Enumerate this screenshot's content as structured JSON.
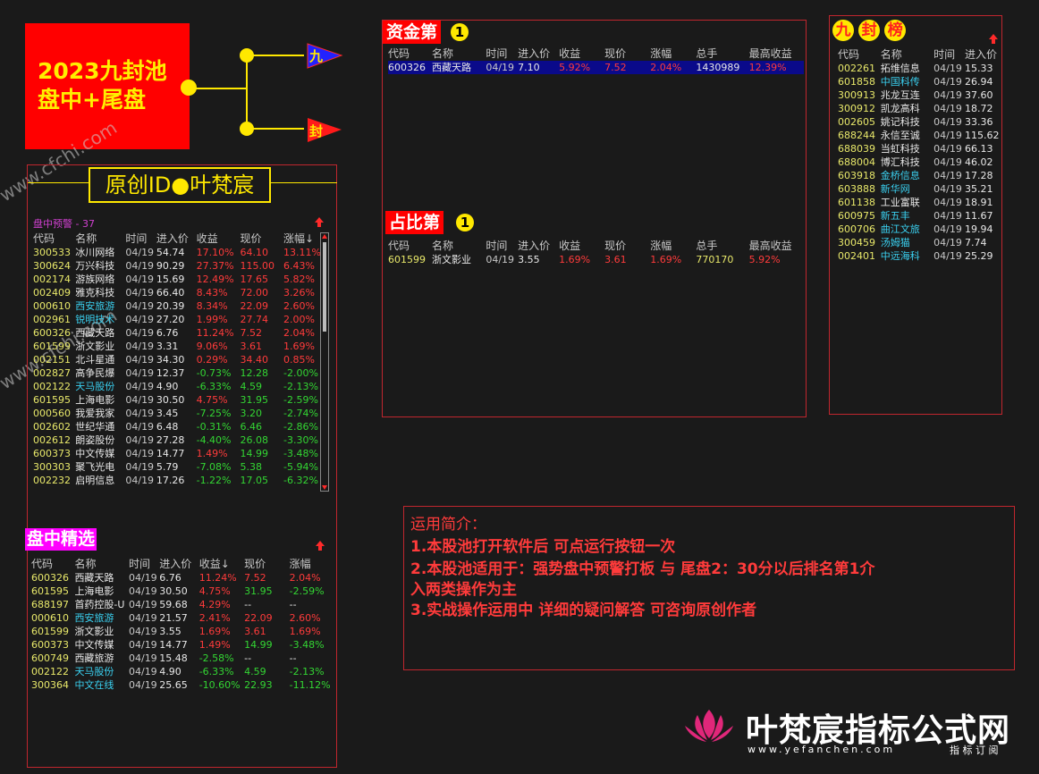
{
  "logo": {
    "line1": "2023九封池",
    "line2": "盘中+尾盘"
  },
  "flow": {
    "flag_top": "九",
    "flag_bottom": "封"
  },
  "creator_banner": "原创ID●叶梵宸",
  "panel_left": {
    "alert_title": "盘中预警 - 37",
    "headers": [
      "代码",
      "名称",
      "时间",
      "进入价",
      "收益",
      "现价",
      "涨幅↓"
    ],
    "rows": [
      [
        "300533",
        "冰川网络",
        "04/19",
        "54.74",
        "17.10%",
        "64.10",
        "13.11%"
      ],
      [
        "300624",
        "万兴科技",
        "04/19",
        "90.29",
        "27.37%",
        "115.00",
        "6.43%"
      ],
      [
        "002174",
        "游族网络",
        "04/19",
        "15.69",
        "12.49%",
        "17.65",
        "5.82%"
      ],
      [
        "002409",
        "雅克科技",
        "04/19",
        "66.40",
        "8.43%",
        "72.00",
        "3.26%"
      ],
      [
        "000610",
        "西安旅游",
        "04/19",
        "20.39",
        "8.34%",
        "22.09",
        "2.60%"
      ],
      [
        "002961",
        "锐明技术",
        "04/19",
        "27.20",
        "1.99%",
        "27.74",
        "2.00%"
      ],
      [
        "600326",
        "西藏天路",
        "04/19",
        "6.76",
        "11.24%",
        "7.52",
        "2.04%"
      ],
      [
        "601599",
        "浙文影业",
        "04/19",
        "3.31",
        "9.06%",
        "3.61",
        "1.69%"
      ],
      [
        "002151",
        "北斗星通",
        "04/19",
        "34.30",
        "0.29%",
        "34.40",
        "0.85%"
      ],
      [
        "002827",
        "高争民爆",
        "04/19",
        "12.37",
        "-0.73%",
        "12.28",
        "-2.00%"
      ],
      [
        "002122",
        "天马股份",
        "04/19",
        "4.90",
        "-6.33%",
        "4.59",
        "-2.13%"
      ],
      [
        "601595",
        "上海电影",
        "04/19",
        "30.50",
        "4.75%",
        "31.95",
        "-2.59%"
      ],
      [
        "000560",
        "我爱我家",
        "04/19",
        "3.45",
        "-7.25%",
        "3.20",
        "-2.74%"
      ],
      [
        "002602",
        "世纪华通",
        "04/19",
        "6.48",
        "-0.31%",
        "6.46",
        "-2.86%"
      ],
      [
        "002612",
        "朗姿股份",
        "04/19",
        "27.28",
        "-4.40%",
        "26.08",
        "-3.30%"
      ],
      [
        "600373",
        "中文传媒",
        "04/19",
        "14.77",
        "1.49%",
        "14.99",
        "-3.48%"
      ],
      [
        "300303",
        "聚飞光电",
        "04/19",
        "5.79",
        "-7.08%",
        "5.38",
        "-5.94%"
      ],
      [
        "002232",
        "启明信息",
        "04/19",
        "17.26",
        "-1.22%",
        "17.05",
        "-6.32%"
      ]
    ],
    "cyan_names": [
      "西安旅游",
      "锐明技术",
      "天马股份"
    ],
    "selected_title": "盘中精选",
    "selected_headers": [
      "代码",
      "名称",
      "时间",
      "进入价",
      "收益↓",
      "现价",
      "涨幅"
    ],
    "selected_rows": [
      [
        "600326",
        "西藏天路",
        "04/19",
        "6.76",
        "11.24%",
        "7.52",
        "2.04%"
      ],
      [
        "601595",
        "上海电影",
        "04/19",
        "30.50",
        "4.75%",
        "31.95",
        "-2.59%"
      ],
      [
        "688197",
        "首药控股-U",
        "04/19",
        "59.68",
        "4.29%",
        "--",
        "--"
      ],
      [
        "000610",
        "西安旅游",
        "04/19",
        "21.57",
        "2.41%",
        "22.09",
        "2.60%"
      ],
      [
        "601599",
        "浙文影业",
        "04/19",
        "3.55",
        "1.69%",
        "3.61",
        "1.69%"
      ],
      [
        "600373",
        "中文传媒",
        "04/19",
        "14.77",
        "1.49%",
        "14.99",
        "-3.48%"
      ],
      [
        "600749",
        "西藏旅游",
        "04/19",
        "15.48",
        "-2.58%",
        "--",
        "--"
      ],
      [
        "002122",
        "天马股份",
        "04/19",
        "4.90",
        "-6.33%",
        "4.59",
        "-2.13%"
      ],
      [
        "300364",
        "中文在线",
        "04/19",
        "25.65",
        "-10.60%",
        "22.93",
        "-11.12%"
      ]
    ],
    "selected_cyan": [
      "西安旅游",
      "天马股份",
      "中文在线"
    ]
  },
  "panel_capital": {
    "title": "资金第",
    "badge": "1",
    "headers": [
      "代码",
      "名称",
      "时间",
      "进入价",
      "收益",
      "现价",
      "涨幅",
      "总手",
      "最高收益"
    ],
    "row": [
      "600326",
      "西藏天路",
      "04/19",
      "7.10",
      "5.92%",
      "7.52",
      "2.04%",
      "1430989",
      "12.39%"
    ]
  },
  "panel_ratio": {
    "title": "占比第",
    "badge": "1",
    "headers": [
      "代码",
      "名称",
      "时间",
      "进入价",
      "收益",
      "现价",
      "涨幅",
      "总手",
      "最高收益"
    ],
    "row": [
      "601599",
      "浙文影业",
      "04/19",
      "3.55",
      "1.69%",
      "3.61",
      "1.69%",
      "770170",
      "5.92%"
    ]
  },
  "panel_nine": {
    "title_chars": [
      "九",
      "封",
      "榜"
    ],
    "headers": [
      "代码",
      "名称",
      "时间",
      "进入价"
    ],
    "rows": [
      [
        "002261",
        "拓维信息",
        "04/19",
        "15.33"
      ],
      [
        "601858",
        "中国科传",
        "04/19",
        "26.94"
      ],
      [
        "300913",
        "兆龙互连",
        "04/19",
        "37.60"
      ],
      [
        "300912",
        "凯龙高科",
        "04/19",
        "18.72"
      ],
      [
        "002605",
        "姚记科技",
        "04/19",
        "33.36"
      ],
      [
        "688244",
        "永信至诚",
        "04/19",
        "115.62"
      ],
      [
        "688039",
        "当虹科技",
        "04/19",
        "66.13"
      ],
      [
        "688004",
        "博汇科技",
        "04/19",
        "46.02"
      ],
      [
        "603918",
        "金桥信息",
        "04/19",
        "17.28"
      ],
      [
        "603888",
        "新华网",
        "04/19",
        "35.21"
      ],
      [
        "601138",
        "工业富联",
        "04/19",
        "18.91"
      ],
      [
        "600975",
        "新五丰",
        "04/19",
        "11.67"
      ],
      [
        "600706",
        "曲江文旅",
        "04/19",
        "19.94"
      ],
      [
        "300459",
        "汤姆猫",
        "04/19",
        "7.74"
      ],
      [
        "002401",
        "中远海科",
        "04/19",
        "25.29"
      ]
    ],
    "cyan_names": [
      "中国科传",
      "金桥信息",
      "新华网",
      "新五丰",
      "曲江文旅",
      "汤姆猫",
      "中远海科"
    ]
  },
  "intro": {
    "heading": "运用简介：",
    "line1": "1.本股池打开软件后 可点运行按钮一次",
    "line2": "2.本股池适用于：强势盘中预警打板 与 尾盘2：30分以后排名第1介",
    "line3": "入两类操作为主",
    "line4": "3.实战操作运用中 详细的疑问解答 可咨询原创作者"
  },
  "brand": {
    "name": "叶梵宸指标公式网",
    "url": "www.yefanchen.com",
    "tagline": "指 标 订 阅"
  },
  "watermark": "www.cfchi.com",
  "colors": {
    "accent_red": "#c0262e",
    "logo_red": "#ff0000",
    "logo_text": "#ffee00",
    "panel_border": "#c0262e",
    "up": "#ff3b3b",
    "down": "#33d633"
  }
}
